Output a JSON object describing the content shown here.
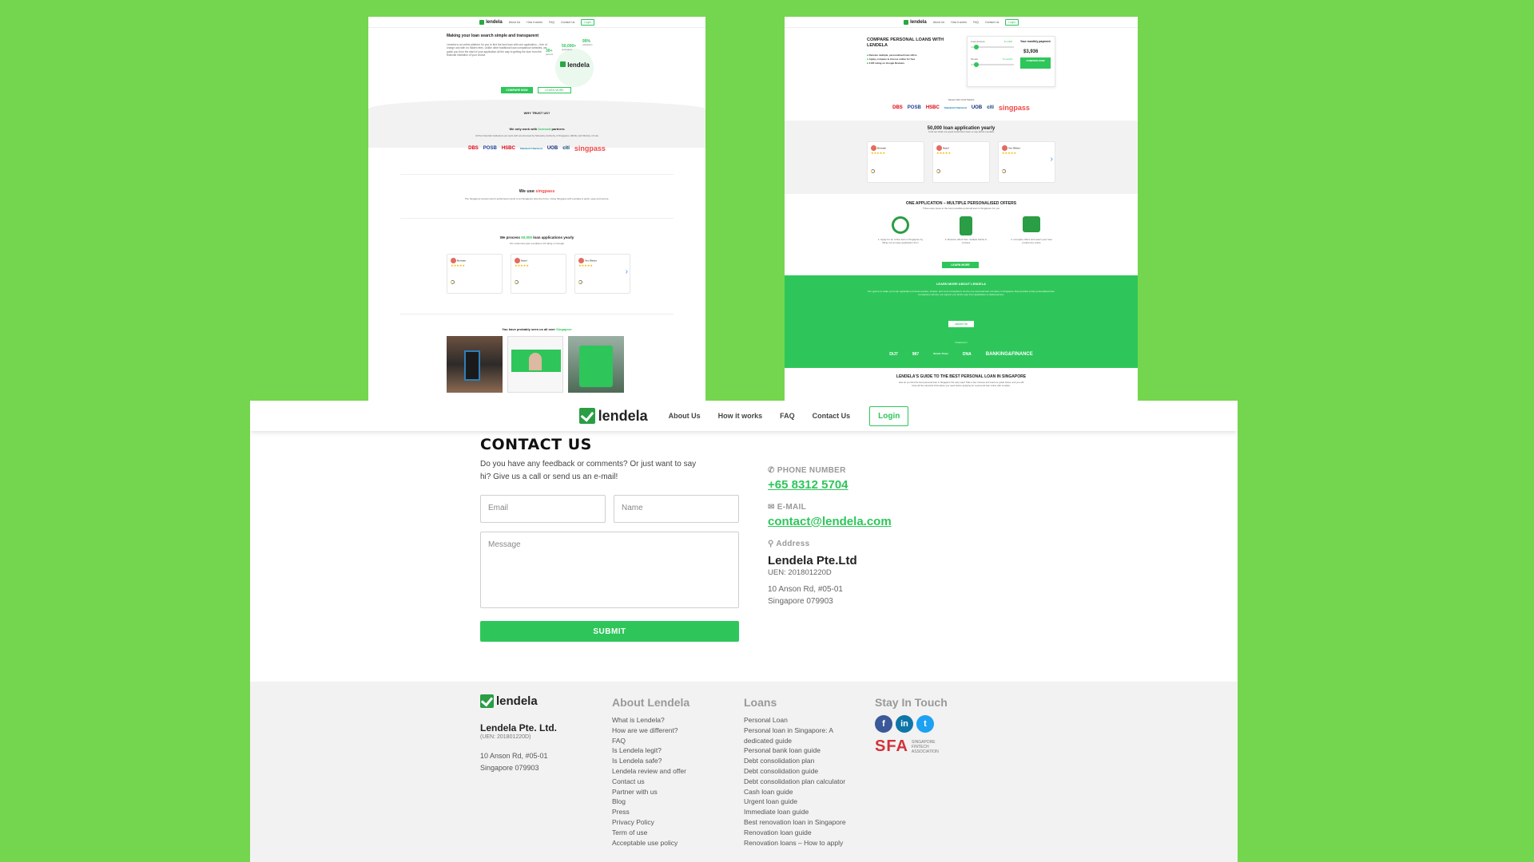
{
  "brand": {
    "name": "lendela",
    "accent": "#2ec65a",
    "background": "#74d64e"
  },
  "nav": {
    "links": [
      "About Us",
      "How it works",
      "FAQ",
      "Contact Us"
    ],
    "login": "Login"
  },
  "left_shot": {
    "hero_title": "Making your loan search simple and transparent",
    "hero_body": "Lendela is an online platform for you to find the best loan with one application – free of charge and with no hidden fees. Unlike other traditional loan comparison websites, we guide you from the start of your application all the way to getting the loan from the financial institution of your choice.",
    "stat1": "30+",
    "stat1_label": "partners",
    "stat2": "50,000+",
    "stat2_label": "applications",
    "stat3": "99%",
    "stat3_label": "satisfaction",
    "btn_primary": "COMPARE NOW",
    "btn_secondary": "LEARN MORE",
    "why_trust": "WHY TRUST US?",
    "licensed_pre": "We only work with",
    "licensed_word": "licensed",
    "licensed_post": "partners",
    "licensed_body": "All the financial institutions we work with are licensed by Monetary Authority of Singapore (MAS) and Ministry of Law",
    "banks": [
      "DBS",
      "POSB",
      "HSBC",
      "Standard Chartered",
      "UOB",
      "citi"
    ],
    "singpass": "singpass",
    "use_pre": "We use",
    "singpass_body": "The Singapore Government's authorised myinfo to let Singapore skip the forms. Using Singpass with Lendela is quick, easy and secure.",
    "process_pre": "We process",
    "process_num": "50,000",
    "process_post": "loan applications yearly",
    "process_sub": "Our customers give Lendela a 4.8 rating on Google",
    "reviewers": [
      "Norman",
      "Hazel",
      "Yeo Weber"
    ],
    "seen_pre": "You have probably seen us all over",
    "seen_word": "Singapore"
  },
  "right_shot": {
    "hero_title": "COMPARE PERSONAL LOANS WITH LENDELA",
    "checks": [
      "Receive multiple, personalised loan offers",
      "Apply, compare & choose online for free",
      "4.8/5 rating on Google Reviews"
    ],
    "loan_amount_label": "Loan amount",
    "loan_amount_value": "$ 1,000",
    "tenure_label": "Tenure",
    "tenure_value": "6 months",
    "monthly_label": "Your monthly payment",
    "monthly_value": "$3,936",
    "compare_btn": "COMPARE NOW",
    "partners_label": "SELECTED PARTNERS",
    "apps_title": "50,000 loan application yearly",
    "apps_sub": "Find out what our great customers have to say about Lendela",
    "one_app_title": "ONE APPLICATION – MULTIPLE PERSONALISED OFFERS",
    "one_app_sub": "Three easy steps to the best possible personal loan in Singapore for you",
    "steps": [
      "1. Apply for an online loan in Singapore by filling out an easy application form",
      "2. Receive offers from multiple banks in minutes",
      "3. Compare offers and select your loan preference online"
    ],
    "learn_btn": "LEARN MORE",
    "about_title": "LEARN MORE ABOUT LENDELA",
    "about_body": "Our goal is to make your loan application process quicker, simpler, and more transparent. As the one personal loan company in Singapore that provides a fully personalised loan comparison service, we support you all the way from application to disbursement.",
    "about_btn": "ABOUT US",
    "featured_label": "Featured in",
    "press": [
      "DIJ7",
      "987",
      "Straits Times",
      "DNA",
      "BANKING&FINANCE"
    ],
    "guide_title": "LENDELA'S GUIDE TO THE BEST PERSONAL LOAN IN SINGAPORE",
    "guide_body": "How do you find the best personal loan in Singapore the easy way? Take a few minutes and read our guide below, and you will have all the important information you need before applying for a personal loan online with Lendela."
  },
  "contact": {
    "title": "CONTACT US",
    "subtitle": "Do you have any feedback or comments? Or just want to say hi? Give us a call or send us an e-mail!",
    "email_placeholder": "Email",
    "name_placeholder": "Name",
    "message_placeholder": "Message",
    "submit": "SUBMIT",
    "phone_label": "PHONE NUMBER",
    "phone": "+65 8312 5704",
    "email_label": "E-MAIL",
    "email": "contact@lendela.com",
    "address_label": "Address",
    "company": "Lendela Pte.Ltd",
    "uen": "UEN: 201801220D",
    "addr1": "10 Anson Rd, #05-01",
    "addr2": "Singapore 079903"
  },
  "footer": {
    "company": "Lendela Pte. Ltd.",
    "uen": "(UEN: 201801220D)",
    "addr1": "10 Anson Rd, #05-01",
    "addr2": "Singapore 079903",
    "about_head": "About Lendela",
    "about_links": [
      "What is Lendela?",
      "How are we different?",
      "FAQ",
      "Is Lendela legit?",
      "Is Lendela safe?",
      "Lendela review and offer",
      "Contact us",
      "Partner with us",
      "Blog",
      "Press",
      "Privacy Policy",
      "Term of use",
      "Acceptable use policy"
    ],
    "loans_head": "Loans",
    "loans_links": [
      "Personal Loan",
      "Personal loan in Singapore: A",
      "dedicated guide",
      "Personal bank loan guide",
      "Debt consolidation plan",
      "Debt consolidation guide",
      "Debt consolidation plan calculator",
      "Cash loan guide",
      "Urgent loan guide",
      "Immediate loan guide",
      "Best renovation loan in Singapore",
      "Renovation loan guide",
      "Renovation loans – How to apply"
    ],
    "stay_head": "Stay In Touch",
    "sfa": "SFA",
    "sfa_text": "SINGAPORE FINTECH ASSOCIATION"
  }
}
